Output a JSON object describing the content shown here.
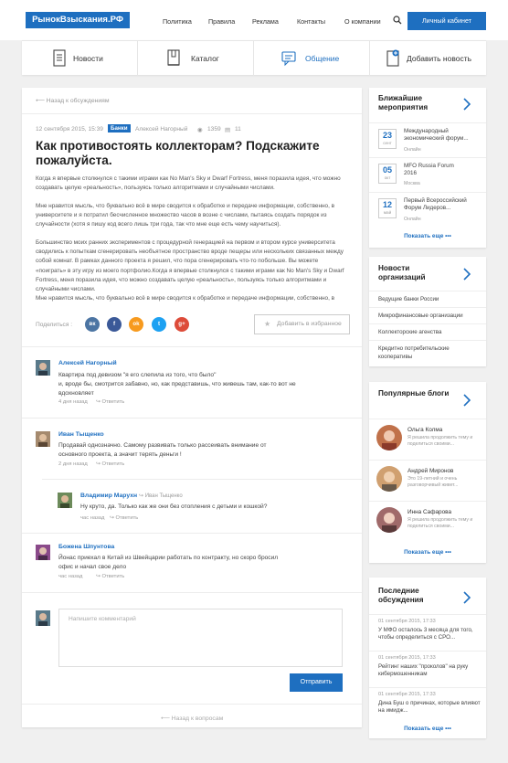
{
  "header": {
    "logo": "РынокВзыскания.РФ",
    "nav": [
      "Политика",
      "Правила",
      "Реклама",
      "Контакты",
      "О компании"
    ],
    "cabinet": "Личный кабинет"
  },
  "sections": [
    {
      "label": "Новости",
      "icon": "document-icon"
    },
    {
      "label": "Каталог",
      "icon": "book-icon"
    },
    {
      "label": "Общение",
      "icon": "chat-icon"
    },
    {
      "label": "Добавить новость",
      "icon": "add-document-icon"
    }
  ],
  "article": {
    "back": "Назад к обсуждениям",
    "date": "12 сентября 2015, 15:39",
    "category": "Банки",
    "author": "Алексей Нагорный",
    "views": "1359",
    "comments": "11",
    "title": "Как противостоять коллекторам? Подскажите пожалуйста.",
    "paragraphs": [
      "Когда я впервые столкнулся с такими играми как No Man's Sky и Dwarf Fortress, меня поразила идея, что можно создавать целую «реальность», пользуясь только алгоритмами и случайными числами.",
      "Мне нравится мысль, что буквально всё в мире сводится к обработке и передаче информации, собственно, в университете и я потратил бесчисленное множество часов в возне с числами, пытаясь создать порядок из случайности (хотя я пишу код всего лишь три года, так что мне еще есть чему научиться).",
      "Большинство моих ранних экспериментов с процедурной генерацией на первом и втором курсе университета сводились к попыткам сгенерировать необъятное пространство вроде пещеры или нескольких связанных между собой комнат. В рамках данного проекта я решил, что пора сгенерировать что-то побольше. Вы можете «поиграть» в эту игру из моего портфолио.Когда я впервые столкнулся с такими играми как No Man's Sky и Dwarf Fortress, меня поразила идея, что можно создавать целую «реальность», пользуясь только алгоритмами и случайными числами.\nМне нравится мысль, что буквально всё в мире сводится к обработке и передаче информации, собственно, в"
    ],
    "share_label": "Поделиться :",
    "social": [
      {
        "name": "vk-icon",
        "text": "вк",
        "color": "#4c75a3"
      },
      {
        "name": "facebook-icon",
        "text": "f",
        "color": "#3b5998"
      },
      {
        "name": "odnoklassniki-icon",
        "text": "ok",
        "color": "#f79a1e"
      },
      {
        "name": "twitter-icon",
        "text": "t",
        "color": "#1da1f2"
      },
      {
        "name": "google-plus-icon",
        "text": "g+",
        "color": "#dd4b39"
      }
    ],
    "favorite": "Добавить в избранное"
  },
  "comments": [
    {
      "name": "Алексей Нагорный",
      "text": "Квартира под девизом \"я его слепила из того, что было\"\nи, вроде бы, смотрится забавно, но, как представишь, что живешь там, как-то вот не вдохновляет",
      "time": "4 дня назад",
      "reply": "Ответить"
    },
    {
      "name": "Иван Тыщенко",
      "text": "Продавай однозначно. Самому развивать только рассеивать внимание от основного проекта, а значит терять деньги !",
      "time": "2 дня назад",
      "reply": "Ответить"
    },
    {
      "name": "Владимир Марухн",
      "replyto": "Иван Тыщенко",
      "text": "Ну круто, да. Только как же они без отопления с детьми и кошкой?",
      "time": "час назад",
      "reply": "Ответить"
    },
    {
      "name": "Божена Шпунтова",
      "text": "Йонас приехал в Китай из Швейцарии работать по контракту, но скоро бросил офис и начал свое дело",
      "time": "час назад",
      "reply": "Ответить"
    }
  ],
  "form": {
    "placeholder": "Напишите комментарий",
    "send": "Отправить",
    "back": "Назад к вопросам"
  },
  "events": {
    "title": "Ближайшие мероприятия",
    "more": "Показать еще",
    "items": [
      {
        "day": "23",
        "month": "сент",
        "title": "Международный экономический форум...",
        "loc": "Онлайн"
      },
      {
        "day": "05",
        "month": "окт",
        "title": "MFO Russia Forum 2016",
        "loc": "Москва"
      },
      {
        "day": "12",
        "month": "май",
        "title": "Первый Всероссийский Форум Лидеров...",
        "loc": "Онлайн"
      }
    ]
  },
  "orgs": {
    "title": "Новости организаций",
    "items": [
      "Ведущие банки России",
      "Микрофинансовые организации",
      "Коллекторские агенства",
      "Кредитно потребительские кооперативы"
    ]
  },
  "blogs": {
    "title": "Популярные блоги",
    "more": "Показать еще",
    "items": [
      {
        "name": "Ольга Колма",
        "desc": "Я решила продолжить тему и поделиться своими..."
      },
      {
        "name": "Андрей Миронов",
        "desc": "Это 19-летний и очень разговорчивый живет..."
      },
      {
        "name": "Инна Сафарова",
        "desc": "Я решила продолжить тему и поделиться своими..."
      }
    ]
  },
  "discussions": {
    "title": "Последние обсуждения",
    "more": "Показать еще",
    "items": [
      {
        "date": "01 сентября 2015, 17:33",
        "text": "У МФО осталось 3 месяца для того, чтобы определиться с СРО..."
      },
      {
        "date": "01 сентября 2015, 17:33",
        "text": "Рейтинг наших \"проколов\" на руку кибермошенникам"
      },
      {
        "date": "01 сентября 2015, 17:33",
        "text": "Дина Буш о причинах, которые влияют на имидж..."
      }
    ]
  }
}
